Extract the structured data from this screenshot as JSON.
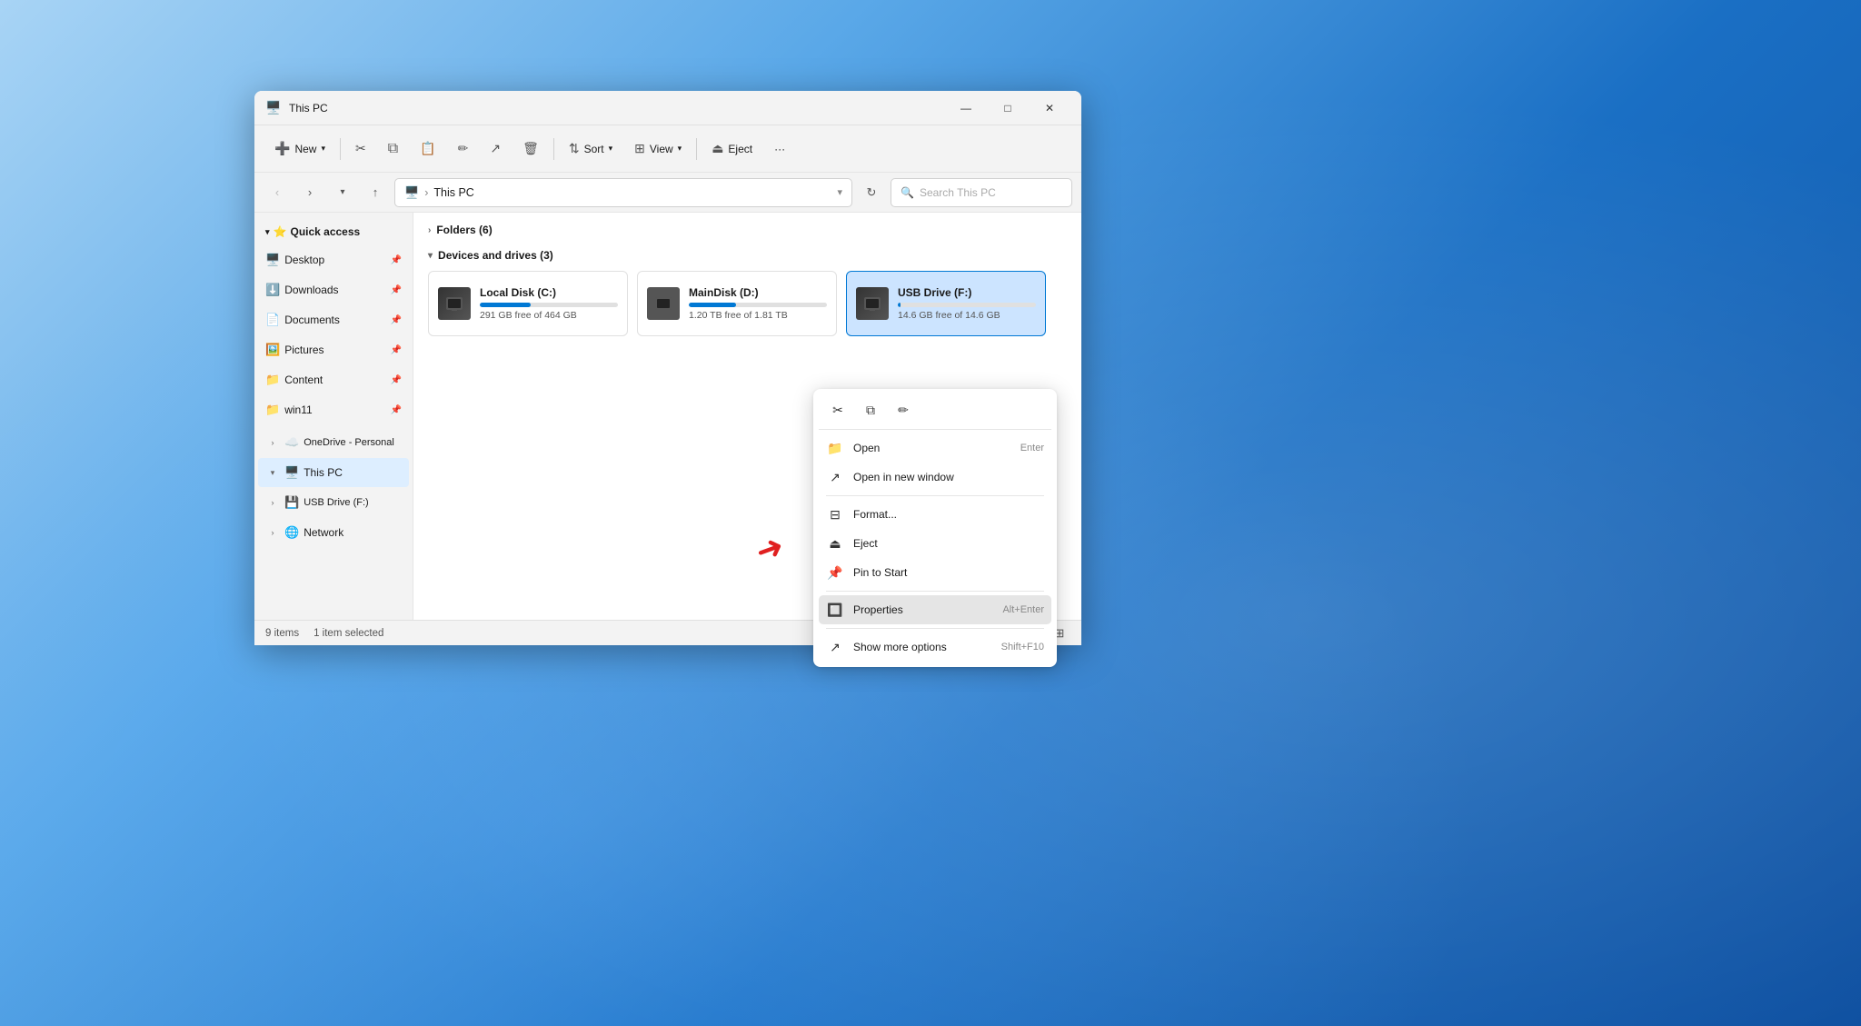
{
  "window": {
    "title": "This PC",
    "icon": "🖥️"
  },
  "title_controls": {
    "minimize": "—",
    "maximize": "□",
    "close": "✕"
  },
  "toolbar": {
    "new_label": "New",
    "new_icon": "➕",
    "cut_icon": "✂",
    "copy_icon": "⧉",
    "paste_icon": "📋",
    "rename_icon": "✏",
    "share_icon": "↗",
    "delete_icon": "🗑",
    "sort_label": "Sort",
    "sort_icon": "⇅",
    "view_label": "View",
    "view_icon": "⊞",
    "eject_label": "Eject",
    "eject_icon": "⏏",
    "more_icon": "···"
  },
  "address_bar": {
    "path_icon": "🖥️",
    "path_text": "This PC",
    "search_placeholder": "Search This PC"
  },
  "sidebar": {
    "quick_access_label": "Quick access",
    "quick_access_star": "⭐",
    "items": [
      {
        "label": "Desktop",
        "icon": "🖥️",
        "pinned": true
      },
      {
        "label": "Downloads",
        "icon": "⬇️",
        "pinned": true
      },
      {
        "label": "Documents",
        "icon": "📄",
        "pinned": true
      },
      {
        "label": "Pictures",
        "icon": "🖼️",
        "pinned": true
      },
      {
        "label": "Content",
        "icon": "📁",
        "pinned": true
      },
      {
        "label": "win11",
        "icon": "📁",
        "pinned": true
      }
    ],
    "onedrive_label": "OneDrive - Personal",
    "thispc_label": "This PC",
    "usb_label": "USB Drive (F:)",
    "network_label": "Network"
  },
  "content": {
    "folders_header": "Folders (6)",
    "devices_header": "Devices and drives (3)",
    "drives": [
      {
        "name": "Local Disk (C:)",
        "free": "291 GB free of 464 GB",
        "fill_pct": 37,
        "icon": "💿"
      },
      {
        "name": "MainDisk (D:)",
        "free": "1.20 TB free of 1.81 TB",
        "fill_pct": 34,
        "icon": "💿"
      },
      {
        "name": "USB Drive (F:)",
        "free": "14.6 GB free of 14.6 GB",
        "fill_pct": 2,
        "icon": "💿",
        "selected": true
      }
    ]
  },
  "status_bar": {
    "items_count": "9 items",
    "selected_count": "1 item selected"
  },
  "context_menu": {
    "top_icons": [
      "✂",
      "⧉",
      "✏"
    ],
    "items": [
      {
        "icon": "📁",
        "label": "Open",
        "shortcut": "Enter"
      },
      {
        "icon": "↗",
        "label": "Open in new window",
        "shortcut": ""
      },
      {
        "icon": "⊟",
        "label": "Format...",
        "shortcut": ""
      },
      {
        "icon": "⏏",
        "label": "Eject",
        "shortcut": ""
      },
      {
        "icon": "📌",
        "label": "Pin to Start",
        "shortcut": ""
      },
      {
        "icon": "🔲",
        "label": "Properties",
        "shortcut": "Alt+Enter",
        "highlighted": true
      },
      {
        "icon": "↗",
        "label": "Show more options",
        "shortcut": "Shift+F10"
      }
    ]
  }
}
